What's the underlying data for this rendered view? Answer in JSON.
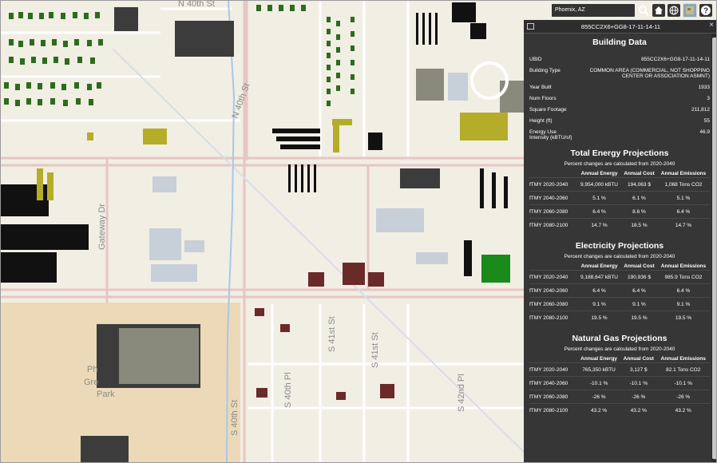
{
  "search": {
    "value": "Phoenix, AZ"
  },
  "toolbar": {
    "icons": [
      "search-icon",
      "home-icon",
      "globe-icon",
      "basemap-icon",
      "help-icon"
    ]
  },
  "map": {
    "street_labels": {
      "n40th_top": "N 40th St",
      "n40th_mid": "N 40th St",
      "gateway": "Gateway Dr",
      "s40th_pl": "S 40th Pl",
      "s40th_st": "S 40th St",
      "s41st_a": "S 41st St",
      "s41st_b": "S 41st St",
      "s42nd": "S 42nd Pl",
      "park": "Phoenix Greenway Park",
      "park_1": "Ph",
      "park_2": "Gre",
      "park_3": "Park"
    }
  },
  "panel": {
    "header": "855CC2X6+GG8-17-11-14-11",
    "building": {
      "title": "Building Data",
      "rows": [
        {
          "label": "UBID",
          "value": "855CC2X6+GG8-17-11-14-11"
        },
        {
          "label": "Building Type",
          "value": "COMMON AREA (COMMERCIAL, NOT SHOPPING CENTER OR ASSOCIATION ASMNT)"
        },
        {
          "label": "Year Built",
          "value": "1933"
        },
        {
          "label": "Num Floors",
          "value": "3"
        },
        {
          "label": "Square Footage",
          "value": "211,812"
        },
        {
          "label": "Height (ft)",
          "value": "55"
        },
        {
          "label": "Energy Use Intensity (kBTU/sf)",
          "value": "46.9"
        }
      ]
    },
    "sections": [
      {
        "title": "Total Energy Projections",
        "note": "Percent changes are calculated from 2020-2040",
        "headers": [
          "",
          "Annual Energy",
          "Annual Cost",
          "Annual Emissions"
        ],
        "rows": [
          [
            "fTMY 2020-2040",
            "9,954,000 kBTU",
            "194,063 $",
            "1,068 Tons CO2"
          ],
          [
            "fTMY 2040-2060",
            "5.1 %",
            "6.1 %",
            "5.1 %"
          ],
          [
            "fTMY 2060-2080",
            "6.4 %",
            "8.6 %",
            "6.4 %"
          ],
          [
            "fTMY 2080-2100",
            "14.7 %",
            "18.5 %",
            "14.7 %"
          ]
        ]
      },
      {
        "title": "Electricity Projections",
        "note": "Percent changes are calculated from 2020-2040",
        "headers": [
          "",
          "Annual Energy",
          "Annual Cost",
          "Annual Emissions"
        ],
        "rows": [
          [
            "fTMY 2020-2040",
            "9,188,647 kBTU",
            "190,936 $",
            "985.9 Tons CO2"
          ],
          [
            "fTMY 2040-2060",
            "6.4 %",
            "6.4 %",
            "6.4 %"
          ],
          [
            "fTMY 2060-2080",
            "9.1 %",
            "9.1 %",
            "9.1 %"
          ],
          [
            "fTMY 2080-2100",
            "19.5 %",
            "19.5 %",
            "19.5 %"
          ]
        ]
      },
      {
        "title": "Natural Gas Projections",
        "note": "Percent changes are calculated from 2020-2040",
        "headers": [
          "",
          "Annual Energy",
          "Annual Cost",
          "Annual Emissions"
        ],
        "rows": [
          [
            "fTMY 2020-2040",
            "765,350 kBTU",
            "3,127 $",
            "82.1 Tons CO2"
          ],
          [
            "fTMY 2040-2060",
            "-10.1 %",
            "-10.1 %",
            "-10.1 %"
          ],
          [
            "fTMY 2060-2080",
            "-26 %",
            "-26 %",
            "-26 %"
          ],
          [
            "fTMY 2080-2100",
            "43.2 %",
            "43.2 %",
            "43.2 %"
          ]
        ]
      }
    ]
  },
  "colors": {
    "panel_bg": "#363636",
    "selected_building": "#1a8a1a",
    "residential": "#2e6b1e",
    "commercial_dark": "#111111",
    "industrial": "#6b2a2a",
    "park_sand": "#ecd9b8",
    "highlight_olive": "#b5ad2a"
  }
}
